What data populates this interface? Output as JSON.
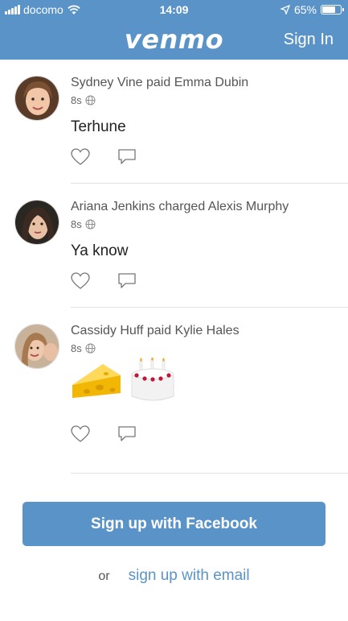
{
  "status_bar": {
    "carrier": "docomo",
    "time": "14:09",
    "battery": "65%",
    "battery_level": 0.65
  },
  "header": {
    "logo": "venmo",
    "sign_in": "Sign In"
  },
  "feed": [
    {
      "headline": "Sydney Vine paid Emma Dubin",
      "time": "8s",
      "note": "Terhune"
    },
    {
      "headline": "Ariana Jenkins charged Alexis Murphy",
      "time": "8s",
      "note": "Ya know"
    },
    {
      "headline": "Cassidy Huff paid Kylie Hales",
      "time": "8s",
      "note": "🧀🎂"
    }
  ],
  "cta": {
    "facebook": "Sign up with Facebook",
    "or": "or",
    "email": "sign up with email"
  },
  "colors": {
    "brand": "#5a93c8"
  }
}
